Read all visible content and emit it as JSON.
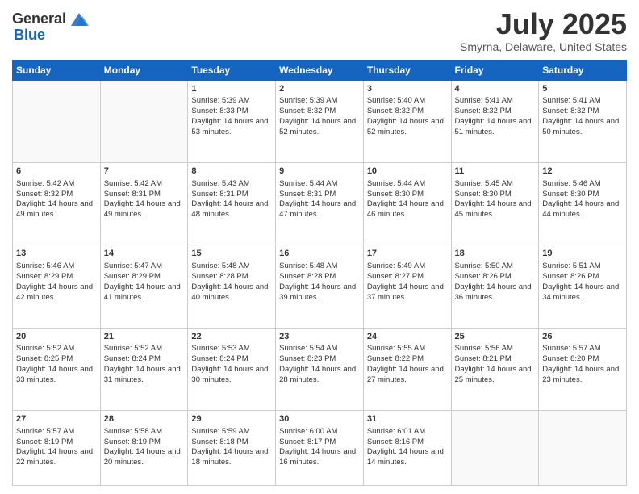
{
  "header": {
    "logo_general": "General",
    "logo_blue": "Blue",
    "month_title": "July 2025",
    "subtitle": "Smyrna, Delaware, United States"
  },
  "days_of_week": [
    "Sunday",
    "Monday",
    "Tuesday",
    "Wednesday",
    "Thursday",
    "Friday",
    "Saturday"
  ],
  "weeks": [
    [
      {
        "day": "",
        "sunrise": "",
        "sunset": "",
        "daylight": "",
        "empty": true
      },
      {
        "day": "",
        "sunrise": "",
        "sunset": "",
        "daylight": "",
        "empty": true
      },
      {
        "day": "1",
        "sunrise": "Sunrise: 5:39 AM",
        "sunset": "Sunset: 8:33 PM",
        "daylight": "Daylight: 14 hours and 53 minutes."
      },
      {
        "day": "2",
        "sunrise": "Sunrise: 5:39 AM",
        "sunset": "Sunset: 8:32 PM",
        "daylight": "Daylight: 14 hours and 52 minutes."
      },
      {
        "day": "3",
        "sunrise": "Sunrise: 5:40 AM",
        "sunset": "Sunset: 8:32 PM",
        "daylight": "Daylight: 14 hours and 52 minutes."
      },
      {
        "day": "4",
        "sunrise": "Sunrise: 5:41 AM",
        "sunset": "Sunset: 8:32 PM",
        "daylight": "Daylight: 14 hours and 51 minutes."
      },
      {
        "day": "5",
        "sunrise": "Sunrise: 5:41 AM",
        "sunset": "Sunset: 8:32 PM",
        "daylight": "Daylight: 14 hours and 50 minutes."
      }
    ],
    [
      {
        "day": "6",
        "sunrise": "Sunrise: 5:42 AM",
        "sunset": "Sunset: 8:32 PM",
        "daylight": "Daylight: 14 hours and 49 minutes."
      },
      {
        "day": "7",
        "sunrise": "Sunrise: 5:42 AM",
        "sunset": "Sunset: 8:31 PM",
        "daylight": "Daylight: 14 hours and 49 minutes."
      },
      {
        "day": "8",
        "sunrise": "Sunrise: 5:43 AM",
        "sunset": "Sunset: 8:31 PM",
        "daylight": "Daylight: 14 hours and 48 minutes."
      },
      {
        "day": "9",
        "sunrise": "Sunrise: 5:44 AM",
        "sunset": "Sunset: 8:31 PM",
        "daylight": "Daylight: 14 hours and 47 minutes."
      },
      {
        "day": "10",
        "sunrise": "Sunrise: 5:44 AM",
        "sunset": "Sunset: 8:30 PM",
        "daylight": "Daylight: 14 hours and 46 minutes."
      },
      {
        "day": "11",
        "sunrise": "Sunrise: 5:45 AM",
        "sunset": "Sunset: 8:30 PM",
        "daylight": "Daylight: 14 hours and 45 minutes."
      },
      {
        "day": "12",
        "sunrise": "Sunrise: 5:46 AM",
        "sunset": "Sunset: 8:30 PM",
        "daylight": "Daylight: 14 hours and 44 minutes."
      }
    ],
    [
      {
        "day": "13",
        "sunrise": "Sunrise: 5:46 AM",
        "sunset": "Sunset: 8:29 PM",
        "daylight": "Daylight: 14 hours and 42 minutes."
      },
      {
        "day": "14",
        "sunrise": "Sunrise: 5:47 AM",
        "sunset": "Sunset: 8:29 PM",
        "daylight": "Daylight: 14 hours and 41 minutes."
      },
      {
        "day": "15",
        "sunrise": "Sunrise: 5:48 AM",
        "sunset": "Sunset: 8:28 PM",
        "daylight": "Daylight: 14 hours and 40 minutes."
      },
      {
        "day": "16",
        "sunrise": "Sunrise: 5:48 AM",
        "sunset": "Sunset: 8:28 PM",
        "daylight": "Daylight: 14 hours and 39 minutes."
      },
      {
        "day": "17",
        "sunrise": "Sunrise: 5:49 AM",
        "sunset": "Sunset: 8:27 PM",
        "daylight": "Daylight: 14 hours and 37 minutes."
      },
      {
        "day": "18",
        "sunrise": "Sunrise: 5:50 AM",
        "sunset": "Sunset: 8:26 PM",
        "daylight": "Daylight: 14 hours and 36 minutes."
      },
      {
        "day": "19",
        "sunrise": "Sunrise: 5:51 AM",
        "sunset": "Sunset: 8:26 PM",
        "daylight": "Daylight: 14 hours and 34 minutes."
      }
    ],
    [
      {
        "day": "20",
        "sunrise": "Sunrise: 5:52 AM",
        "sunset": "Sunset: 8:25 PM",
        "daylight": "Daylight: 14 hours and 33 minutes."
      },
      {
        "day": "21",
        "sunrise": "Sunrise: 5:52 AM",
        "sunset": "Sunset: 8:24 PM",
        "daylight": "Daylight: 14 hours and 31 minutes."
      },
      {
        "day": "22",
        "sunrise": "Sunrise: 5:53 AM",
        "sunset": "Sunset: 8:24 PM",
        "daylight": "Daylight: 14 hours and 30 minutes."
      },
      {
        "day": "23",
        "sunrise": "Sunrise: 5:54 AM",
        "sunset": "Sunset: 8:23 PM",
        "daylight": "Daylight: 14 hours and 28 minutes."
      },
      {
        "day": "24",
        "sunrise": "Sunrise: 5:55 AM",
        "sunset": "Sunset: 8:22 PM",
        "daylight": "Daylight: 14 hours and 27 minutes."
      },
      {
        "day": "25",
        "sunrise": "Sunrise: 5:56 AM",
        "sunset": "Sunset: 8:21 PM",
        "daylight": "Daylight: 14 hours and 25 minutes."
      },
      {
        "day": "26",
        "sunrise": "Sunrise: 5:57 AM",
        "sunset": "Sunset: 8:20 PM",
        "daylight": "Daylight: 14 hours and 23 minutes."
      }
    ],
    [
      {
        "day": "27",
        "sunrise": "Sunrise: 5:57 AM",
        "sunset": "Sunset: 8:19 PM",
        "daylight": "Daylight: 14 hours and 22 minutes."
      },
      {
        "day": "28",
        "sunrise": "Sunrise: 5:58 AM",
        "sunset": "Sunset: 8:19 PM",
        "daylight": "Daylight: 14 hours and 20 minutes."
      },
      {
        "day": "29",
        "sunrise": "Sunrise: 5:59 AM",
        "sunset": "Sunset: 8:18 PM",
        "daylight": "Daylight: 14 hours and 18 minutes."
      },
      {
        "day": "30",
        "sunrise": "Sunrise: 6:00 AM",
        "sunset": "Sunset: 8:17 PM",
        "daylight": "Daylight: 14 hours and 16 minutes."
      },
      {
        "day": "31",
        "sunrise": "Sunrise: 6:01 AM",
        "sunset": "Sunset: 8:16 PM",
        "daylight": "Daylight: 14 hours and 14 minutes."
      },
      {
        "day": "",
        "sunrise": "",
        "sunset": "",
        "daylight": "",
        "empty": true
      },
      {
        "day": "",
        "sunrise": "",
        "sunset": "",
        "daylight": "",
        "empty": true
      }
    ]
  ]
}
